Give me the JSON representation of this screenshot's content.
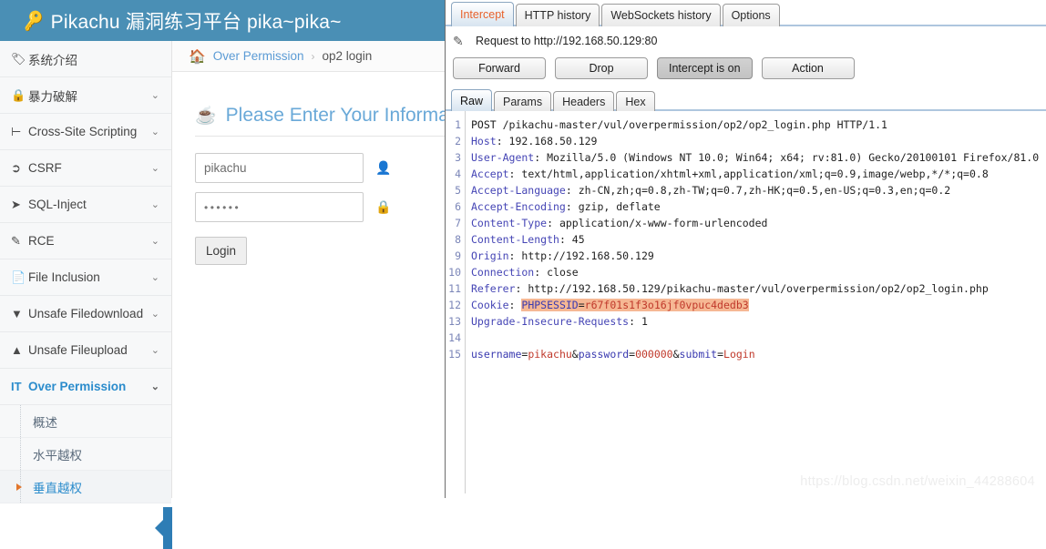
{
  "pikachu": {
    "header": {
      "icon": "key-icon",
      "title": "Pikachu 漏洞练习平台 pika~pika~"
    },
    "sidebar": {
      "items": [
        {
          "icon": "tag-icon",
          "label": "系统介绍",
          "chevron": ""
        },
        {
          "icon": "lock-icon",
          "label": "暴力破解",
          "chevron": "⌄"
        },
        {
          "icon": "xss-icon",
          "label": "Cross-Site Scripting",
          "chevron": "⌄"
        },
        {
          "icon": "share-icon",
          "label": "CSRF",
          "chevron": "⌄"
        },
        {
          "icon": "plane-icon",
          "label": "SQL-Inject",
          "chevron": "⌄"
        },
        {
          "icon": "pencil-icon",
          "label": "RCE",
          "chevron": "⌄"
        },
        {
          "icon": "file-icon",
          "label": "File Inclusion",
          "chevron": "⌄"
        },
        {
          "icon": "download-icon",
          "label": "Unsafe Filedownload",
          "chevron": "⌄"
        },
        {
          "icon": "upload-icon",
          "label": "Unsafe Fileupload",
          "chevron": "⌄"
        },
        {
          "icon": "text-icon",
          "label": "Over Permission",
          "chevron": "⌄",
          "active": true
        }
      ],
      "subitems": [
        {
          "label": "概述",
          "selected": false
        },
        {
          "label": "水平越权",
          "selected": false
        },
        {
          "label": "垂直越权",
          "selected": true
        }
      ]
    },
    "breadcrumb": {
      "home_icon": "home-icon",
      "parent": "Over Permission",
      "separator": "›",
      "current": "op2 login"
    },
    "form": {
      "icon": "coffee-cup-icon",
      "heading": "Please Enter Your Information",
      "username": {
        "value": "pikachu",
        "icon": "user-icon"
      },
      "password": {
        "value": "••••••",
        "icon": "padlock-icon"
      },
      "submit_label": "Login"
    }
  },
  "burp": {
    "main_tabs": [
      {
        "label": "Intercept",
        "selected": true
      },
      {
        "label": "HTTP history",
        "selected": false
      },
      {
        "label": "WebSockets history",
        "selected": false
      },
      {
        "label": "Options",
        "selected": false
      }
    ],
    "request_line": {
      "icon": "pencil-icon",
      "text": "Request to http://192.168.50.129:80"
    },
    "buttons": [
      {
        "label": "Forward",
        "toggled": false
      },
      {
        "label": "Drop",
        "toggled": false
      },
      {
        "label": "Intercept is on",
        "toggled": true
      },
      {
        "label": "Action",
        "toggled": false
      }
    ],
    "view_tabs": [
      {
        "label": "Raw",
        "selected": true
      },
      {
        "label": "Params",
        "selected": false
      },
      {
        "label": "Headers",
        "selected": false
      },
      {
        "label": "Hex",
        "selected": false
      }
    ],
    "raw": {
      "line_numbers": [
        "1",
        "2",
        "3",
        "4",
        "5",
        "6",
        "7",
        "8",
        "9",
        "10",
        "11",
        "12",
        "13",
        "14",
        "15"
      ],
      "lines": [
        "POST /pikachu-master/vul/overpermission/op2/op2_login.php HTTP/1.1",
        "Host: 192.168.50.129",
        "User-Agent: Mozilla/5.0 (Windows NT 10.0; Win64; x64; rv:81.0) Gecko/20100101 Firefox/81.0",
        "Accept: text/html,application/xhtml+xml,application/xml;q=0.9,image/webp,*/*;q=0.8",
        "Accept-Language: zh-CN,zh;q=0.8,zh-TW;q=0.7,zh-HK;q=0.5,en-US;q=0.3,en;q=0.2",
        "Accept-Encoding: gzip, deflate",
        "Content-Type: application/x-www-form-urlencoded",
        "Content-Length: 45",
        "Origin: http://192.168.50.129",
        "Connection: close",
        "Referer: http://192.168.50.129/pikachu-master/vul/overpermission/op2/op2_login.php",
        "Cookie: PHPSESSID=r67f01s1f3o16jf0vpuc4dedb3",
        "Upgrade-Insecure-Requests: 1",
        "",
        "username=pikachu&password=000000&submit=Login"
      ],
      "highlighted_cookie": "PHPSESSID=r67f01s1f3o16jf0vpuc4dedb3",
      "highlight_color": "#f6b894",
      "body_params": [
        {
          "key": "username",
          "value": "pikachu"
        },
        {
          "key": "password",
          "value": "000000"
        },
        {
          "key": "submit",
          "value": "Login"
        }
      ]
    }
  },
  "watermark": "https://blog.csdn.net/weixin_44288604",
  "colors": {
    "app_header": "#4a8fb5",
    "accent_blue": "#2b8ccc",
    "tab_active_text": "#e8622c",
    "highlight": "#f6b894"
  }
}
